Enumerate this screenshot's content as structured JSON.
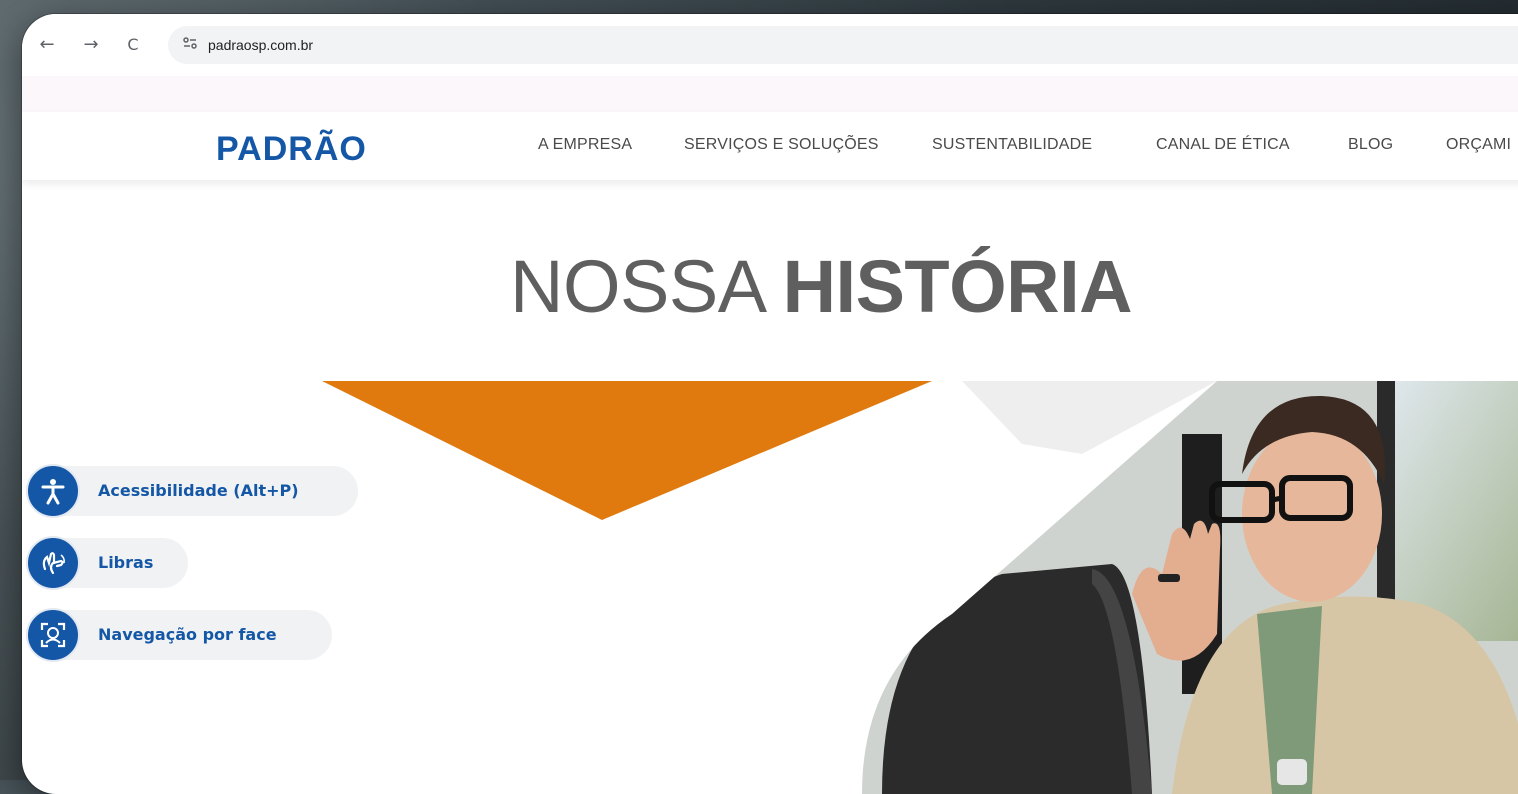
{
  "browser": {
    "url": "padraosp.com.br",
    "back_icon": "←",
    "forward_icon": "→",
    "reload_icon": "C",
    "site_info_icon": "site-info-icon"
  },
  "header": {
    "logo": "PADRÃO",
    "logo_color": "#1457a6",
    "nav": [
      {
        "label": "A EMPRESA"
      },
      {
        "label": "SERVIÇOS E SOLUÇÕES"
      },
      {
        "label": "SUSTENTABILIDADE"
      },
      {
        "label": "CANAL DE ÉTICA"
      },
      {
        "label": "BLOG"
      },
      {
        "label": "ORÇAMI"
      }
    ]
  },
  "hero": {
    "title_light": "NOSSA ",
    "title_bold": "HISTÓRIA",
    "accent_color": "#e07a0f",
    "image": "man-waving-at-laptop"
  },
  "accessibility": {
    "items": [
      {
        "label": "Acessibilidade (Alt+P)",
        "icon": "accessibility-icon"
      },
      {
        "label": "Libras",
        "icon": "sign-language-icon"
      },
      {
        "label": "Navegação por face",
        "icon": "face-scan-icon"
      }
    ],
    "color": "#1457a6"
  }
}
